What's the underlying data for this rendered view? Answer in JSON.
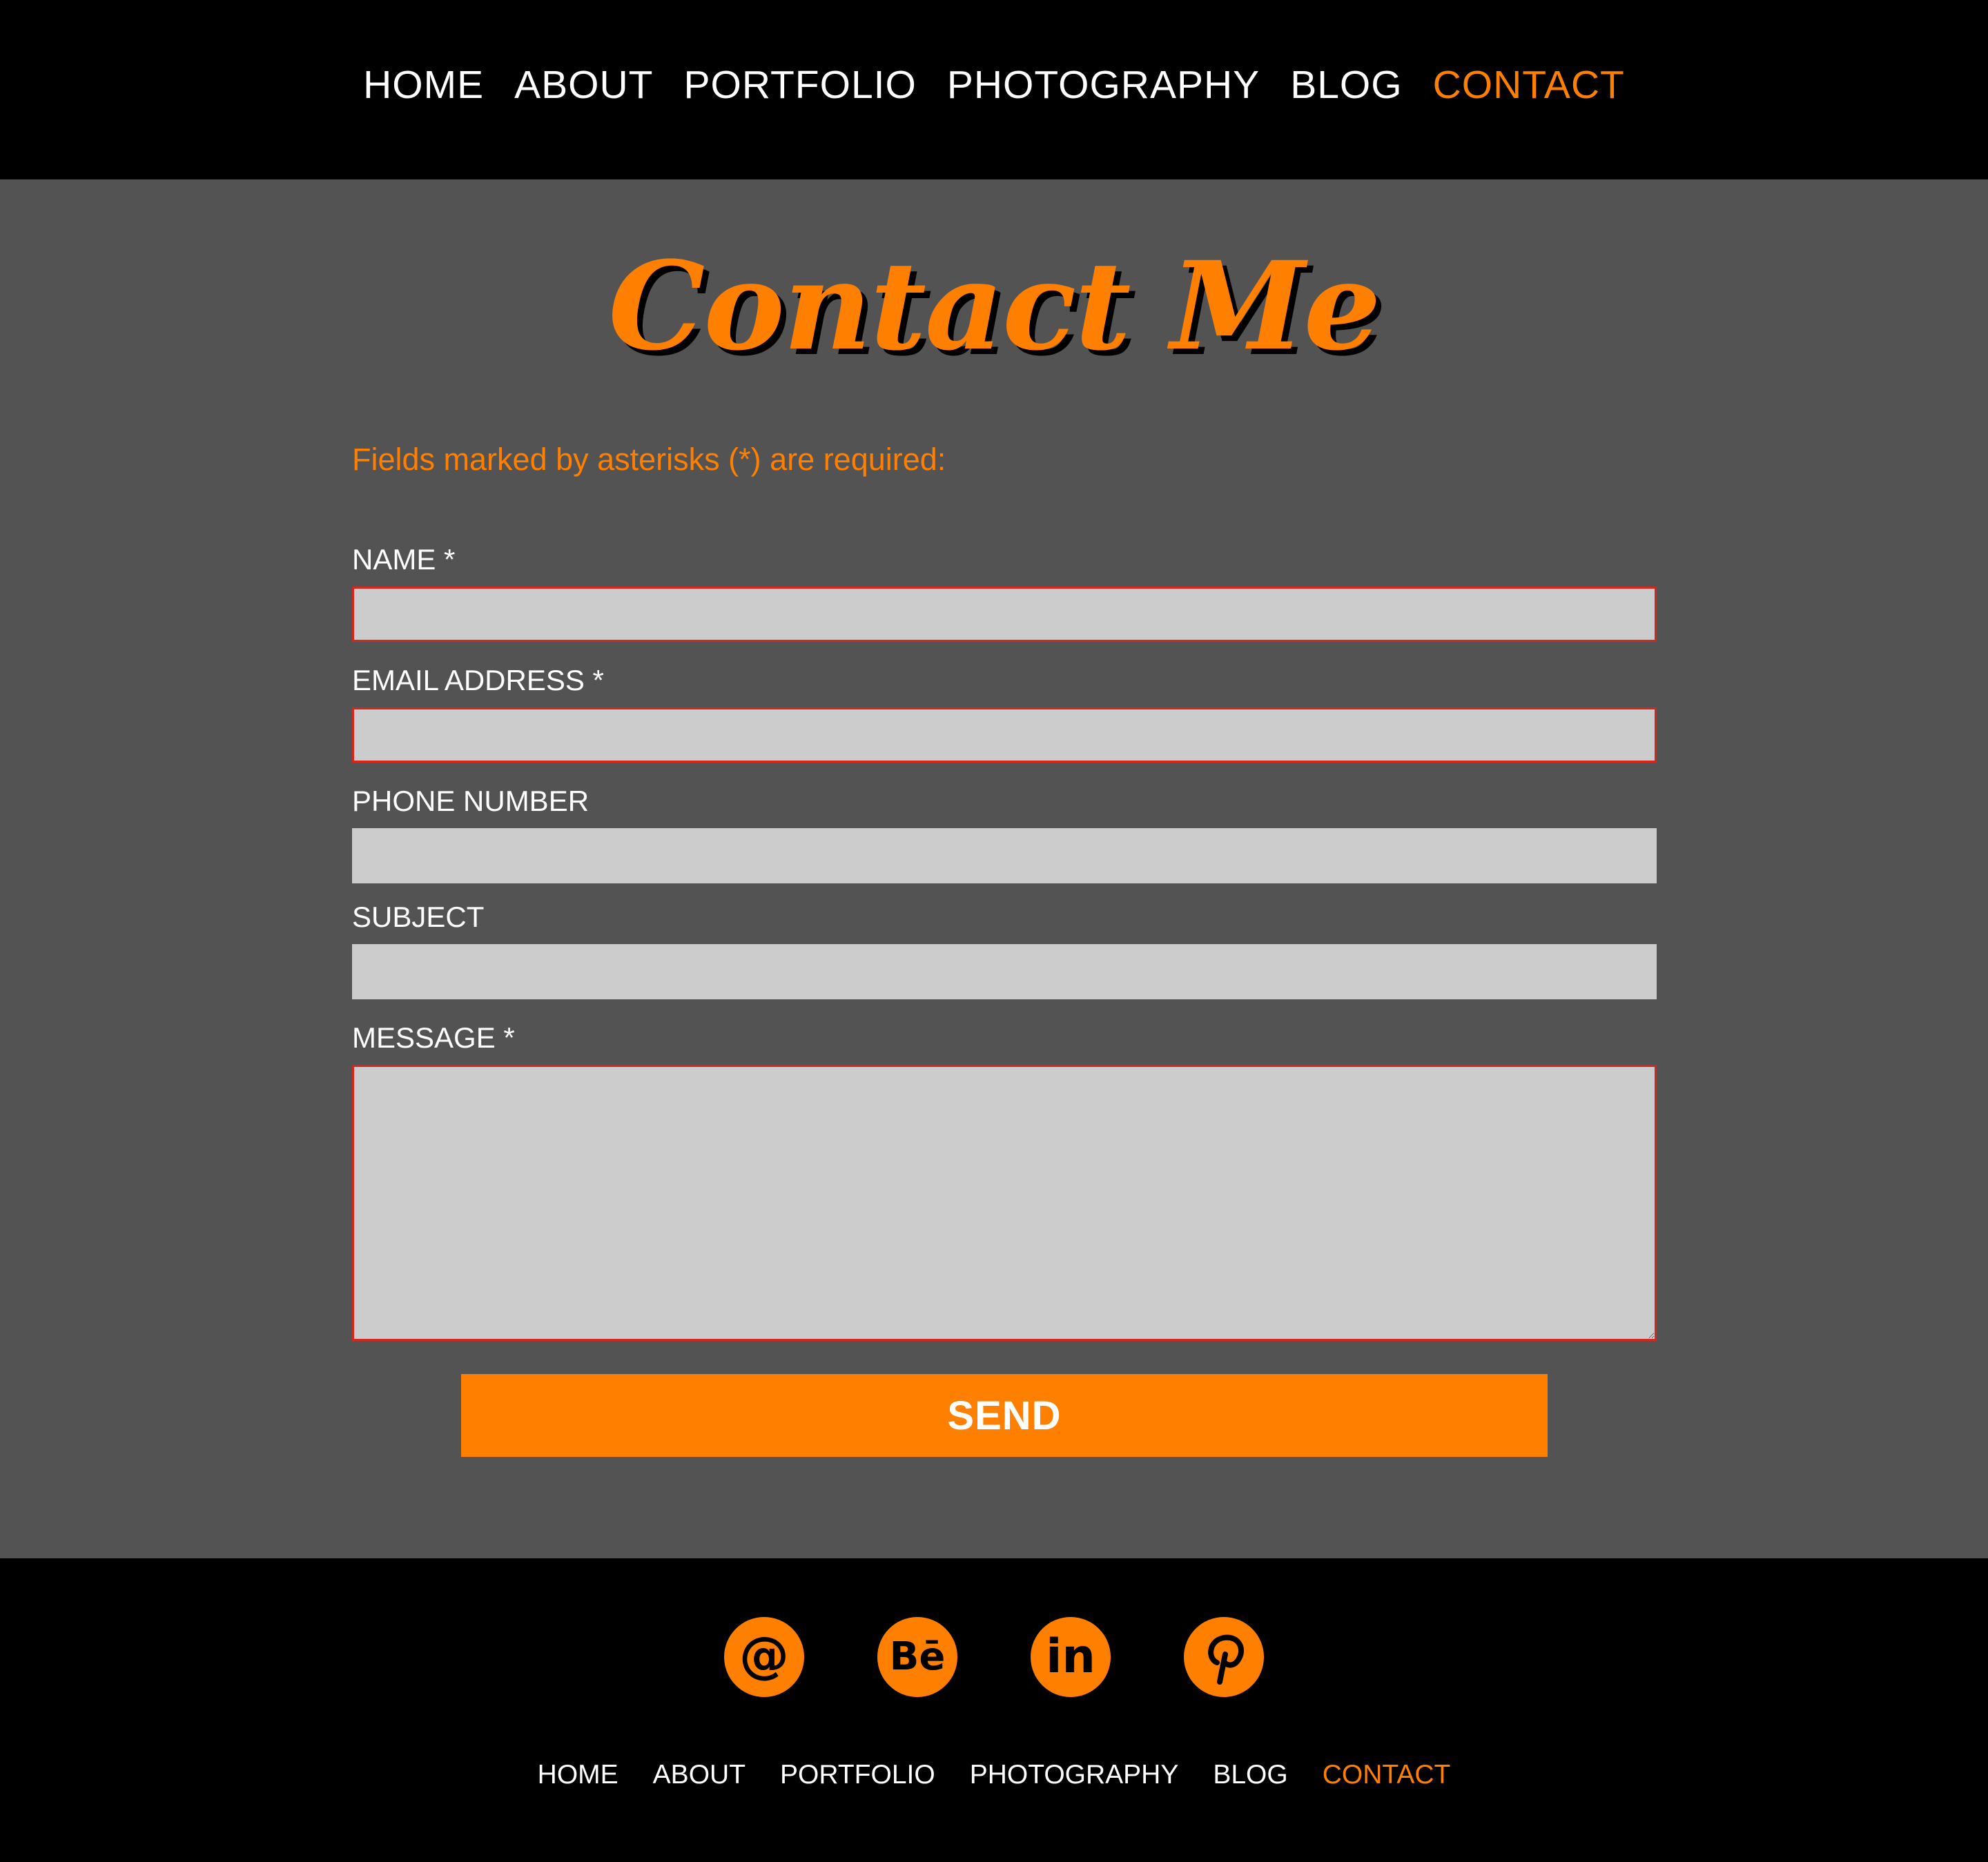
{
  "nav": {
    "items": [
      "HOME",
      "ABOUT",
      "PORTFOLIO",
      "PHOTOGRAPHY",
      "BLOG",
      "CONTACT"
    ],
    "active": "CONTACT"
  },
  "page": {
    "title": "Contact Me",
    "required_note": "Fields marked by asterisks (*) are required:"
  },
  "form": {
    "name_label": "NAME *",
    "email_label": "EMAIL ADDRESS *",
    "phone_label": "PHONE NUMBER",
    "subject_label": "SUBJECT",
    "message_label": "MESSAGE *",
    "name_value": "",
    "email_value": "",
    "phone_value": "",
    "subject_value": "",
    "message_value": "",
    "send_label": "SEND"
  },
  "social": [
    {
      "name": "email-icon",
      "glyph": "@"
    },
    {
      "name": "behance-icon",
      "glyph": "Bē"
    },
    {
      "name": "linkedin-icon",
      "glyph": "in"
    },
    {
      "name": "pinterest-icon",
      "glyph": "P"
    }
  ],
  "footer_nav": {
    "items": [
      "HOME",
      "ABOUT",
      "PORTFOLIO",
      "PHOTOGRAPHY",
      "BLOG",
      "CONTACT"
    ],
    "active": "CONTACT"
  },
  "colors": {
    "accent": "#ff7f00",
    "background": "#535353",
    "nav_background": "#000000",
    "field_background": "#cccccc",
    "required_border": "#d9261c"
  }
}
